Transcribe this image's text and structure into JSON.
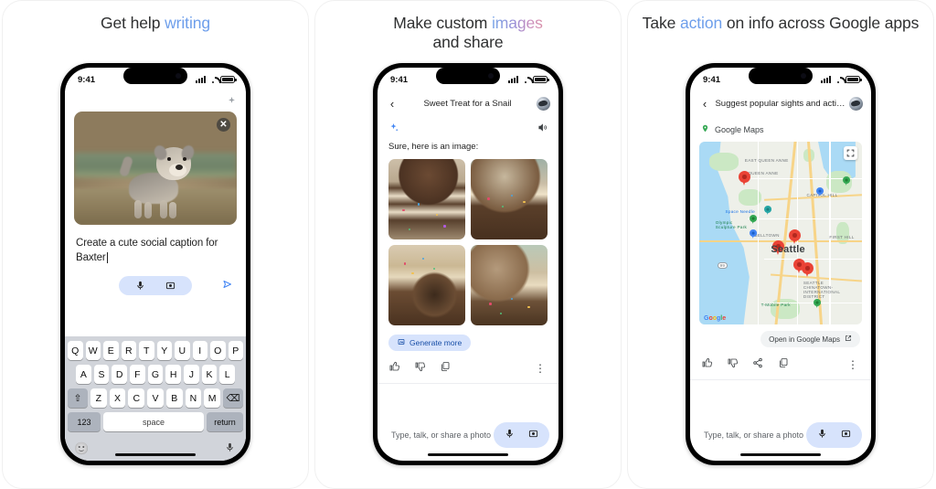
{
  "panels": [
    {
      "headline": {
        "plain_before": "Get help ",
        "accent": "writing",
        "plain_after": "",
        "accent_style": "blue"
      },
      "status_bar": {
        "time": "9:41",
        "signal_icon": "cellular-bars-icon",
        "wifi_icon": "wifi-icon",
        "battery_icon": "battery-icon"
      },
      "attached_image": {
        "alt": "puppy-photo",
        "remove_label": "✕"
      },
      "sparkle_icon": "sparkle-icon",
      "input_text": "Create a cute social caption for Baxter",
      "actions": {
        "mic_icon": "microphone-icon",
        "camera_icon": "camera-lens-icon",
        "send_icon": "send-icon"
      },
      "keyboard": {
        "row1": [
          "Q",
          "W",
          "E",
          "R",
          "T",
          "Y",
          "U",
          "I",
          "O",
          "P"
        ],
        "row2": [
          "A",
          "S",
          "D",
          "F",
          "G",
          "H",
          "J",
          "K",
          "L"
        ],
        "row3": [
          "Z",
          "X",
          "C",
          "V",
          "B",
          "N",
          "M"
        ],
        "shift_label": "⇧",
        "backspace_label": "⌫",
        "numbers_label": "123",
        "space_label": "space",
        "return_label": "return",
        "emoji_label": "🙂",
        "dictate_label": "mic"
      }
    },
    {
      "headline": {
        "plain_before": "Make custom ",
        "accent": "images",
        "plain_after": "and share",
        "accent_style": "gradient"
      },
      "status_bar": {
        "time": "9:41",
        "signal_icon": "cellular-bars-icon",
        "wifi_icon": "wifi-icon",
        "battery_icon": "battery-icon"
      },
      "chat_title": "Sweet Treat for a Snail",
      "back_icon": "back-chevron-icon",
      "avatar_icon": "account-avatar",
      "sparkle_icon": "gemini-sparkle-icon",
      "speaker_icon": "speaker-icon",
      "message": "Sure, here is an image:",
      "images": [
        {
          "name": "snail-on-stacked-cupcakes"
        },
        {
          "name": "snail-on-sprinkle-cupcake"
        },
        {
          "name": "cupcake-with-snail-shell"
        },
        {
          "name": "plate-of-snail-cupcakes"
        }
      ],
      "generate_more": {
        "label": "Generate more",
        "icon": "image-generate-icon"
      },
      "feedback": {
        "thumb_up": "thumb-up-icon",
        "thumb_down": "thumb-down-icon",
        "copy": "copy-icon",
        "more": "more-options-icon"
      },
      "composer": {
        "placeholder": "Type, talk, or share a photo",
        "mic_icon": "microphone-icon",
        "camera_icon": "camera-lens-icon"
      }
    },
    {
      "headline": {
        "plain_before": "Take ",
        "accent": "action",
        "plain_after": " on info across Google apps",
        "accent_style": "blue"
      },
      "status_bar": {
        "time": "9:41",
        "signal_icon": "cellular-bars-icon",
        "wifi_icon": "wifi-icon",
        "battery_icon": "battery-icon"
      },
      "chat_title": "Suggest popular sights and acti…",
      "back_icon": "back-chevron-icon",
      "avatar_icon": "account-avatar",
      "maps_card": {
        "source_label": "Google Maps",
        "source_icon": "map-pin-icon",
        "city_label": "Seattle",
        "expand_icon": "expand-map-icon",
        "watermark": "Google",
        "place_labels": [
          "EAST QUEEN ANNE",
          "QUEEN ANNE",
          "CAPITOL HILL",
          "Space Needle",
          "Olympic Sculpture Park",
          "BELLTOWN",
          "FIRST HILL",
          "SEATTLE CHINATOWN-INTERNATIONAL DISTRICT",
          "T-Mobile Park",
          "99"
        ]
      },
      "open_in_maps": {
        "label": "Open in Google Maps",
        "icon": "external-link-icon"
      },
      "feedback": {
        "thumb_up": "thumb-up-icon",
        "thumb_down": "thumb-down-icon",
        "share": "share-icon",
        "copy": "copy-icon",
        "more": "more-options-icon"
      },
      "composer": {
        "placeholder": "Type, talk, or share a photo",
        "mic_icon": "microphone-icon",
        "camera_icon": "camera-lens-icon"
      }
    }
  ],
  "colors": {
    "accent_blue": "#6d9eeb",
    "chip_bg": "#d7e3fc",
    "pin_red": "#ea4335",
    "google_blue": "#4285f4",
    "google_green": "#34a853",
    "water": "#aadaf5"
  }
}
